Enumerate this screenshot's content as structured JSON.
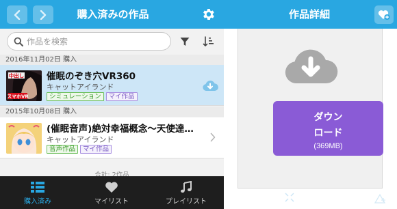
{
  "left_header": {
    "title": "購入済みの作品",
    "back_icon": "chevron-left-icon",
    "forward_icon": "chevron-right-icon",
    "settings_icon": "gear-icon"
  },
  "search": {
    "placeholder": "作品を検索",
    "value": ""
  },
  "groups": [
    {
      "date_label": "2016年11月02日 購入",
      "item": {
        "title": "催眠のぞき穴VR360",
        "maker": "キャットアイランド",
        "tags": [
          "シミュレーション",
          "マイ作品"
        ],
        "thumb_text_top": "中出し",
        "thumb_text_bottom": "スマホVR",
        "action_icon": "cloud-download-icon"
      }
    },
    {
      "date_label": "2015年10月08日 購入",
      "item": {
        "title": "(催眠音声)絶対幸福概念〜天使達…",
        "maker": "キャットアイランド",
        "tags": [
          "音声作品",
          "マイ作品"
        ],
        "action_icon": "chevron-right-icon"
      }
    }
  ],
  "total_label": "合計: 2作品",
  "tabs": [
    {
      "label": "購入済み",
      "icon": "list-icon",
      "active": true
    },
    {
      "label": "マイリスト",
      "icon": "heart-icon",
      "active": false
    },
    {
      "label": "プレイリスト",
      "icon": "music-note-icon",
      "active": false
    }
  ],
  "right_header": {
    "title": "作品詳細",
    "action_icon": "heart-plus-icon"
  },
  "download": {
    "line1": "ダウン",
    "line2": "ロード",
    "size": "(369MB)"
  },
  "colors": {
    "header": "#29a7e1",
    "download_button": "#8a5bd6",
    "selected_row": "#cde6f7",
    "tabbar": "#1e1e1e"
  }
}
